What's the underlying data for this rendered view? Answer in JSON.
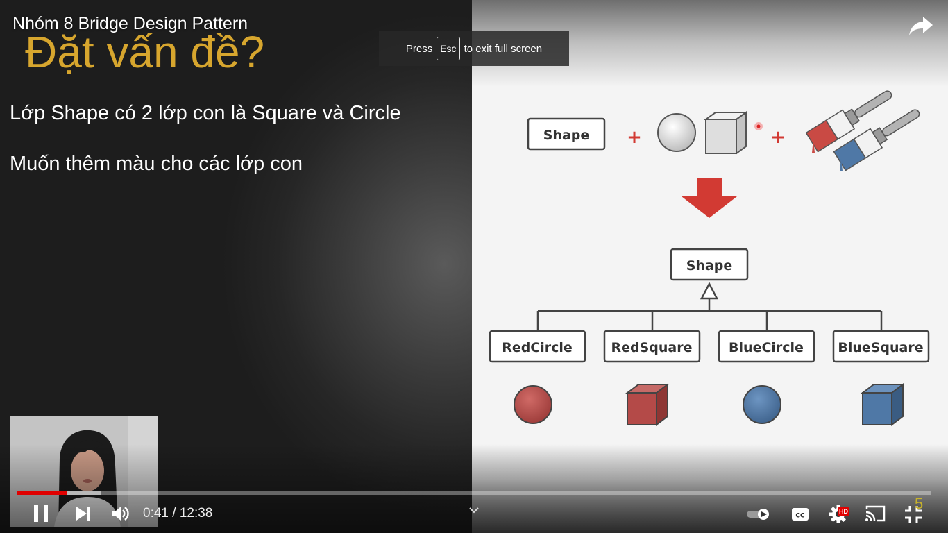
{
  "video": {
    "title": "Nhóm 8 Bridge Design Pattern",
    "current_time": "0:41",
    "duration": "12:38",
    "played_fraction": 0.055,
    "loaded_fraction": 0.092,
    "quality_badge": "HD",
    "corner_number": "5"
  },
  "toast": {
    "prefix": "Press",
    "key": "Esc",
    "suffix": "to exit full screen"
  },
  "slide": {
    "heading": "Đặt vấn đề?",
    "line1": "Lớp Shape có 2 lớp con là Square và Circle",
    "line2": "Muốn thêm màu cho các lớp con"
  },
  "diagram": {
    "top_box": "Shape",
    "plus": "+",
    "parent_box": "Shape",
    "children": [
      "RedCircle",
      "RedSquare",
      "BlueCircle",
      "BlueSquare"
    ]
  },
  "icons": {
    "share": "share-icon",
    "pause": "pause-icon",
    "next": "next-icon",
    "volume": "volume-icon",
    "autoplay": "autoplay-toggle-icon",
    "captions": "captions-icon",
    "settings": "gear-icon",
    "cast": "cast-icon",
    "exit_fullscreen": "exit-fullscreen-icon",
    "chevron": "chevron-down-icon"
  },
  "colors": {
    "progress_played": "#e00000",
    "heading": "#d7a62e",
    "red_shape": "#b44a48",
    "blue_shape": "#4f78a6",
    "arrow": "#d23a33"
  }
}
